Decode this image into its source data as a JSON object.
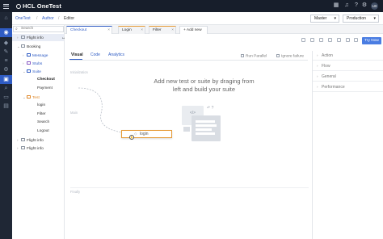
{
  "app": {
    "logo_text": "HCL OneTest",
    "avatar_initials": "LB"
  },
  "breadcrumb": {
    "items": [
      "OneTest",
      "Author",
      "Editor"
    ],
    "separator": "/"
  },
  "selectors": {
    "branch": "Master",
    "environment": "Production"
  },
  "search": {
    "placeholder": "Search"
  },
  "tree": {
    "items": [
      {
        "label": "Flight info",
        "toggle": "›"
      },
      {
        "label": "Booking",
        "toggle": "⌄"
      },
      {
        "label": "Message",
        "toggle": "›"
      },
      {
        "label": "Stubs",
        "toggle": "›"
      },
      {
        "label": "Suite",
        "toggle": "⌄"
      },
      {
        "label": "Checkout"
      },
      {
        "label": "Payment"
      },
      {
        "label": "Test",
        "toggle": "⌄"
      },
      {
        "label": "login"
      },
      {
        "label": "Filter"
      },
      {
        "label": "Search"
      },
      {
        "label": "Logout"
      },
      {
        "label": "Flight info",
        "toggle": "›"
      },
      {
        "label": "Flight info",
        "toggle": "›"
      }
    ]
  },
  "editor_tabs": [
    {
      "label": "Checkout",
      "close": "×"
    },
    {
      "label": "Login",
      "close": "×"
    },
    {
      "label": "Filter",
      "close": "×"
    },
    {
      "label": "Add new",
      "icon": "+"
    }
  ],
  "toolbar": {
    "try_now_label": "Try Now"
  },
  "view_tabs": [
    "Visual",
    "Code",
    "Analytics"
  ],
  "options": {
    "run_parallel": "Run Parallel",
    "ignore_failure": "Ignore failure"
  },
  "zones": {
    "initialization": "Initialization",
    "main": "Main",
    "finally": "Finally"
  },
  "empty_state": {
    "hint": "Add new test or suite by draging from left and build your suite"
  },
  "illustration": {
    "code_glyph": "</>",
    "badge": "↶ ?"
  },
  "drag_chip": {
    "label": "login"
  },
  "right_panel": {
    "sections": [
      "Action",
      "Flow",
      "General",
      "Performance"
    ]
  },
  "colors": {
    "accent": "#2f5cc4",
    "topbar": "#171e2b",
    "rail": "#1f2735",
    "drag_border": "#e69a35",
    "try_now": "#4a7de2"
  },
  "icons": {
    "topbar": [
      "menu-icon",
      "logo-icon",
      "grid-icon",
      "bell-icon",
      "help-icon",
      "settings-icon"
    ],
    "rail": [
      "home-icon",
      "globe-icon",
      "tag-icon",
      "wrench-icon",
      "layers-icon",
      "gear-icon",
      "code-icon",
      "search-icon",
      "monitor-icon",
      "clipboard-icon"
    ]
  }
}
